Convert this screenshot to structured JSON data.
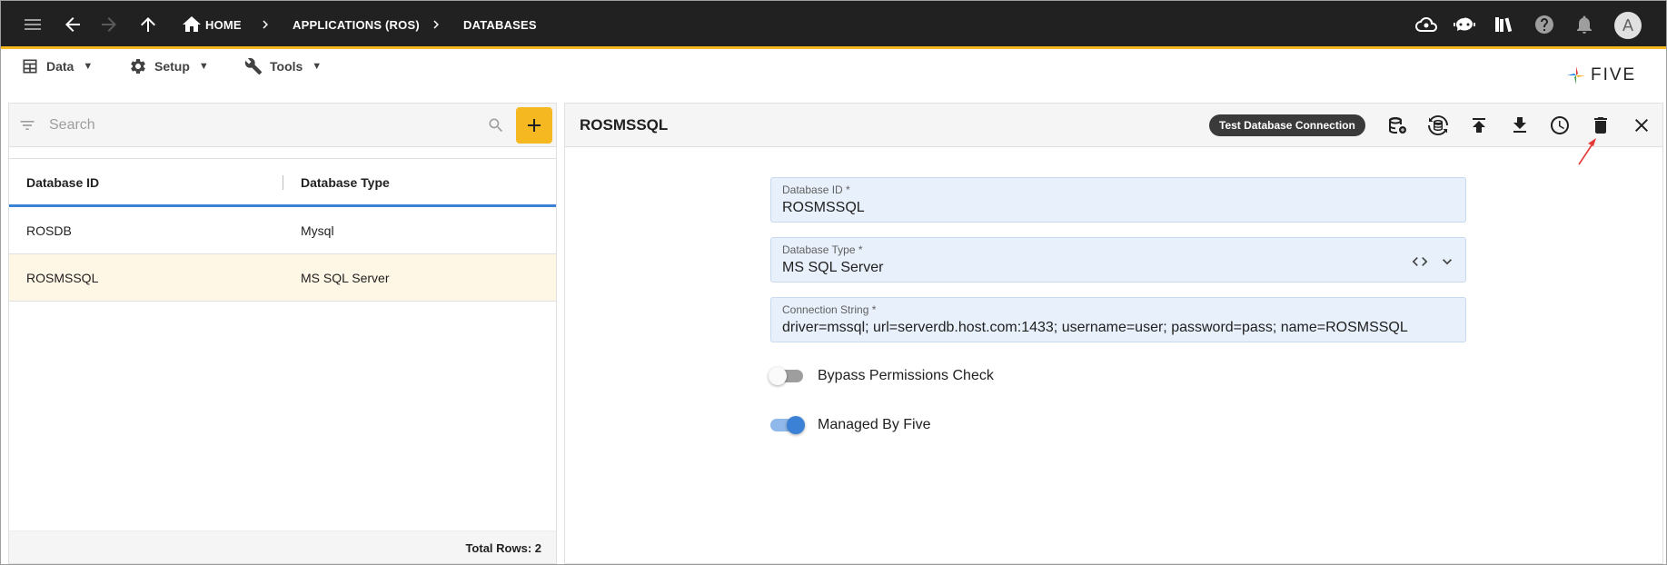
{
  "topbar": {
    "breadcrumbs": [
      "HOME",
      "APPLICATIONS (ROS)",
      "DATABASES"
    ],
    "avatar_letter": "A"
  },
  "menus": [
    {
      "label": "Data",
      "icon": "table-icon"
    },
    {
      "label": "Setup",
      "icon": "gear-icon"
    },
    {
      "label": "Tools",
      "icon": "tools-icon"
    }
  ],
  "logo": {
    "text": "FIVE"
  },
  "list": {
    "search_placeholder": "Search",
    "columns": [
      "Database ID",
      "Database Type"
    ],
    "rows": [
      {
        "id": "ROSDB",
        "type": "Mysql",
        "selected": false
      },
      {
        "id": "ROSMSSQL",
        "type": "MS SQL Server",
        "selected": true
      }
    ],
    "total_rows": "Total Rows: 2"
  },
  "detail": {
    "title": "ROSMSSQL",
    "test_button": "Test Database Connection",
    "fields": {
      "database_id": {
        "label": "Database ID *",
        "value": "ROSMSSQL"
      },
      "database_type": {
        "label": "Database Type *",
        "value": "MS SQL Server"
      },
      "connection_string": {
        "label": "Connection String *",
        "value": "driver=mssql; url=serverdb.host.com:1433; username=user; password=pass; name=ROSMSSQL"
      }
    },
    "toggles": {
      "bypass": {
        "label": "Bypass Permissions Check",
        "on": false
      },
      "managed": {
        "label": "Managed By Five",
        "on": true
      }
    }
  },
  "colors": {
    "accent": "#f5b820",
    "primary": "#3b82d6",
    "selected_row": "#fff7e6",
    "annotation_arrow": "#e53935"
  }
}
